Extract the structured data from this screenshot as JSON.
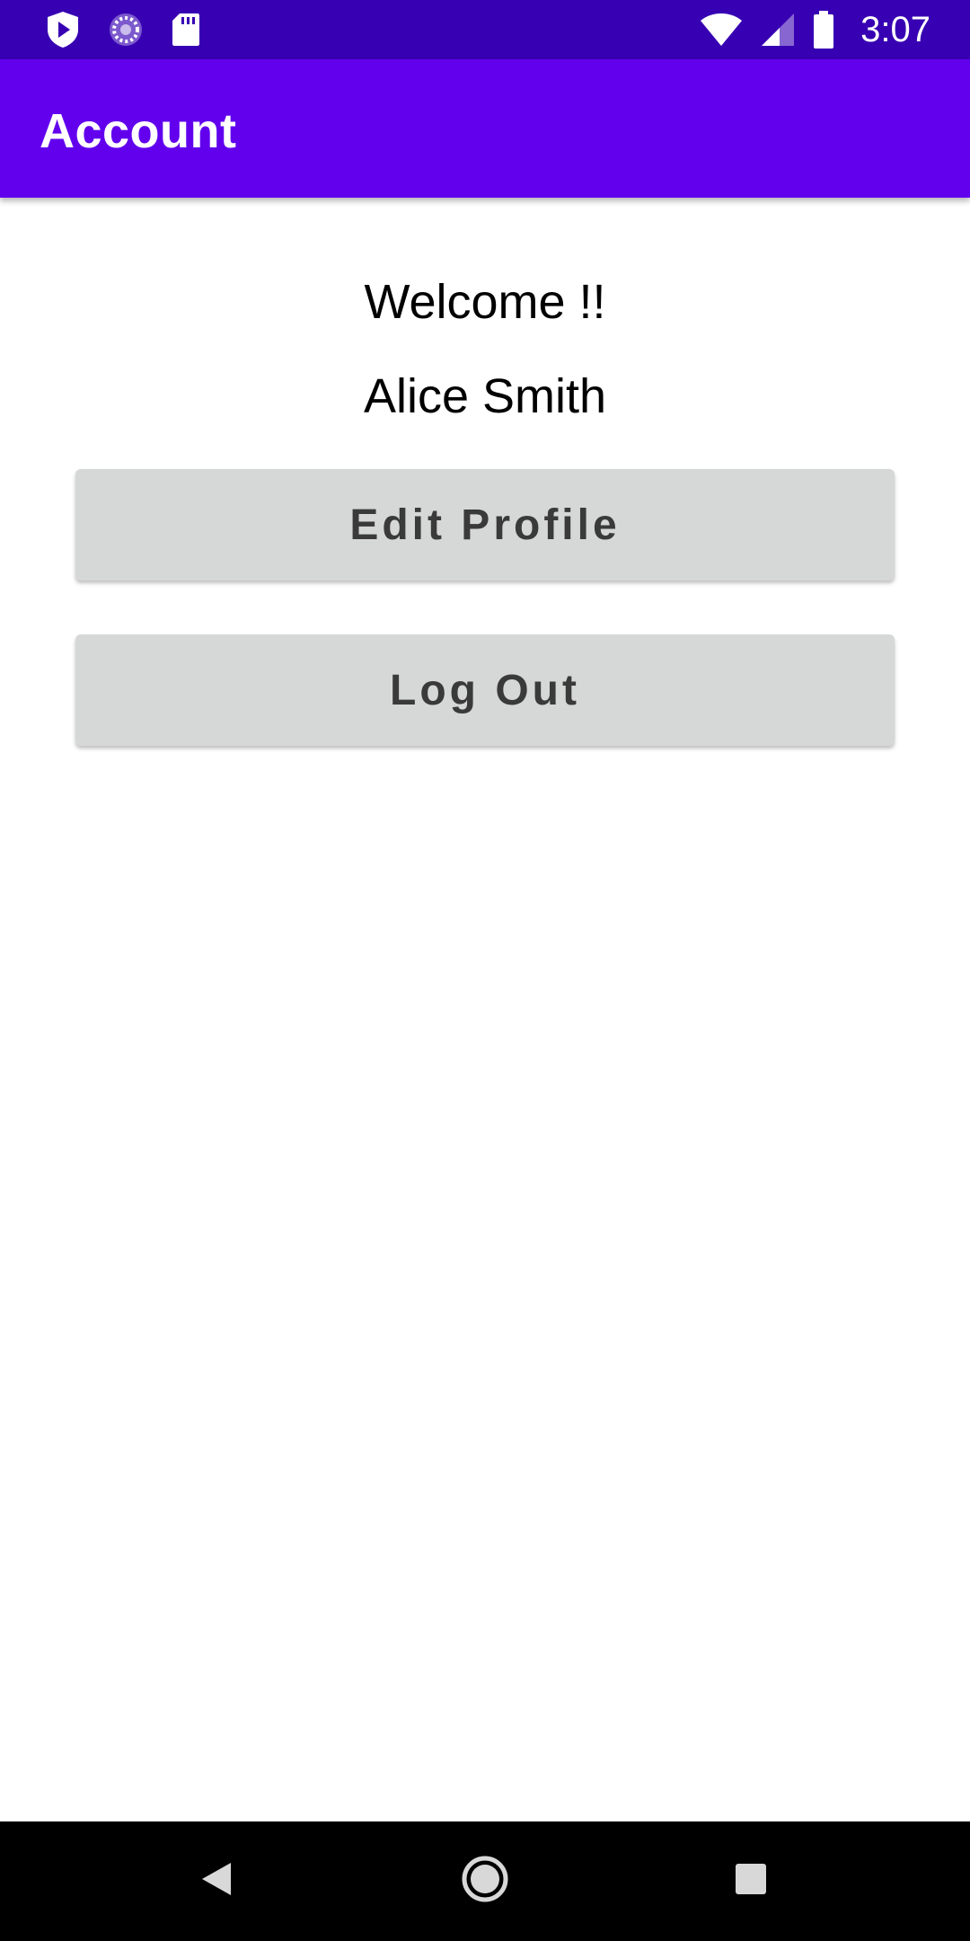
{
  "status_bar": {
    "time": "3:07",
    "icons": [
      "shield-icon",
      "sync-icon",
      "sd-card-icon",
      "wifi-icon",
      "cellular-signal-icon",
      "battery-icon"
    ]
  },
  "app_bar": {
    "title": "Account"
  },
  "content": {
    "welcome_text": "Welcome !!",
    "user_name": "Alice Smith",
    "edit_profile_label": "Edit Profile",
    "log_out_label": "Log Out"
  },
  "navigation": {
    "icons": [
      "back-icon",
      "home-icon",
      "recent-apps-icon"
    ]
  },
  "colors": {
    "status_bar": "#3700b3",
    "app_bar": "#6200ee",
    "button_background": "#d6d7d7",
    "button_text": "#3a3a3a",
    "nav_bar": "#000000"
  }
}
